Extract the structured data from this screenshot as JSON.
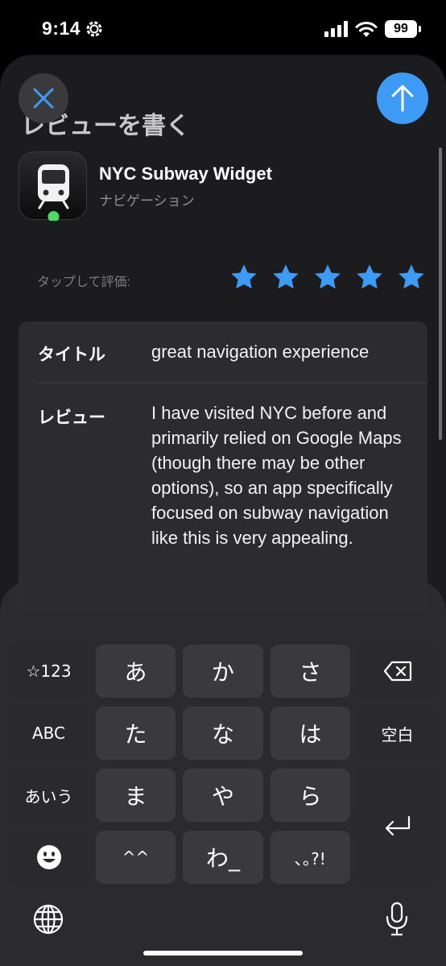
{
  "status": {
    "time": "9:14",
    "battery": "99"
  },
  "sheet": {
    "title": "レビューを書く"
  },
  "app": {
    "name": "NYC Subway Widget",
    "category": "ナビゲーション"
  },
  "rating": {
    "label": "タップして評価:",
    "stars": 5,
    "star_color": "#3d9bf5"
  },
  "form": {
    "title_label": "タイトル",
    "title_value": "great navigation experience",
    "review_label": "レビュー",
    "review_value": "I have visited NYC before and primarily relied on Google Maps (though there may be other options), so an app specifically focused on subway navigation like this is very appealing."
  },
  "keyboard": {
    "row1": [
      "☆123",
      "あ",
      "か",
      "さ"
    ],
    "row2": [
      "ABC",
      "た",
      "な",
      "は",
      "空白"
    ],
    "row3": [
      "あいう",
      "ま",
      "や",
      "ら"
    ],
    "row4": [
      "^^",
      "わ_",
      "､｡?!"
    ],
    "icons": [
      "backspace-icon",
      "return-icon",
      "emoji-icon",
      "globe-icon",
      "microphone-icon"
    ]
  },
  "colors": {
    "accent": "#3d9bf5",
    "background": "#1c1c1e",
    "card": "#2c2c2e"
  }
}
